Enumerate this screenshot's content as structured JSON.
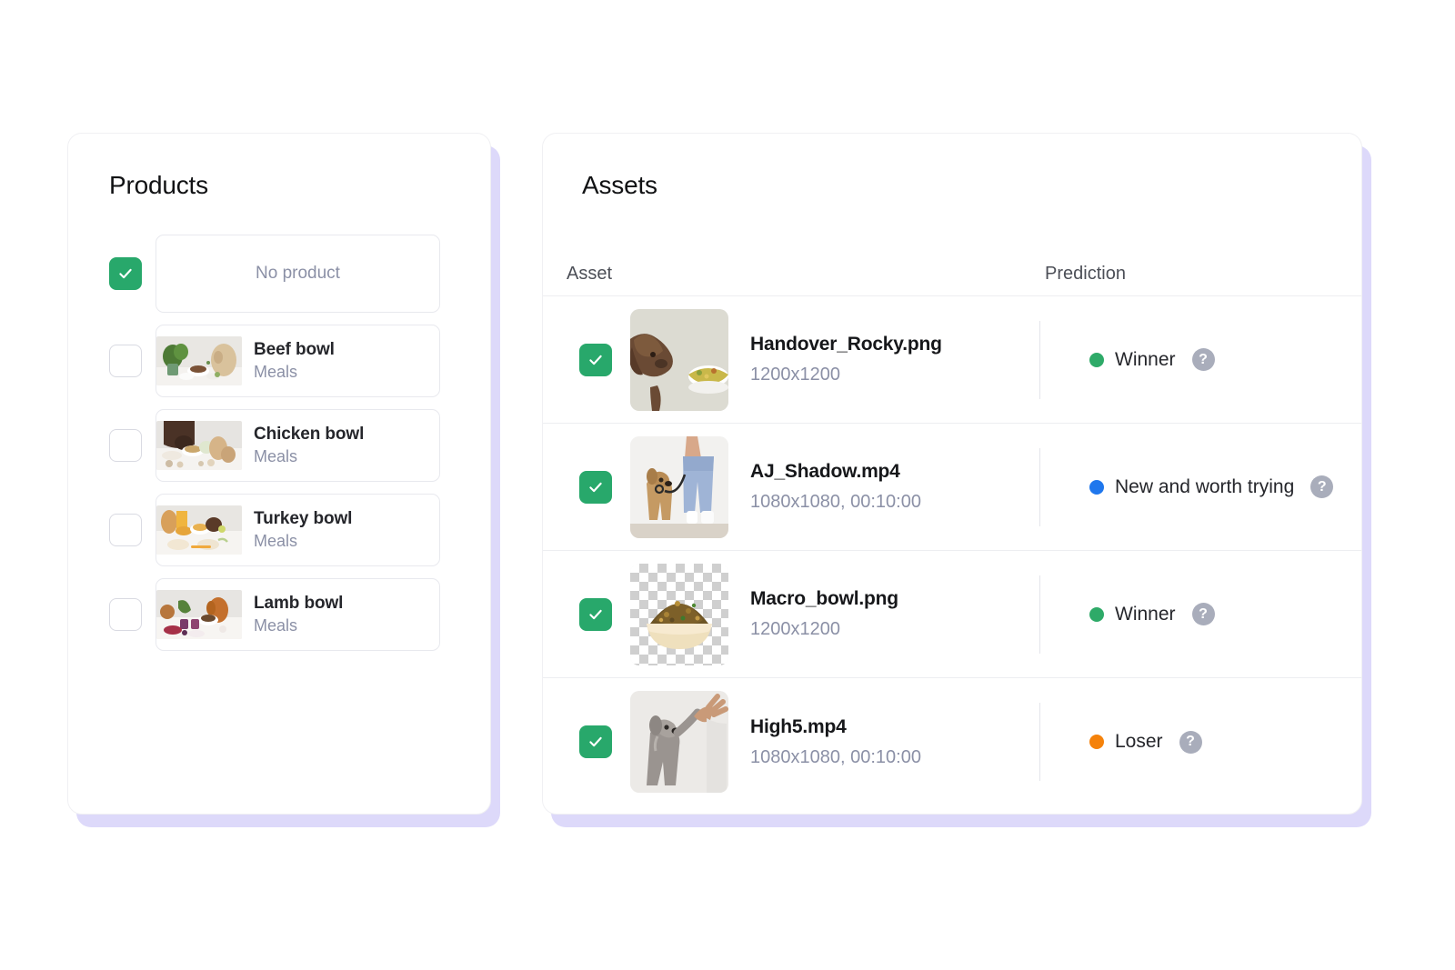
{
  "theme": {
    "accent_green": "#28a86b",
    "status_winner": "#2eaa68",
    "status_new": "#1f77ed",
    "status_loser": "#f5820b",
    "card_shadow": "#ddd9fa",
    "muted_text": "#8b90a6"
  },
  "products_panel": {
    "title": "Products",
    "items": [
      {
        "checked": true,
        "empty": true,
        "empty_label": "No product",
        "name": "",
        "category": "",
        "thumb": "no-product-placeholder"
      },
      {
        "checked": false,
        "empty": false,
        "name": "Beef bowl",
        "category": "Meals",
        "thumb": "beef-bowl-thumbnail"
      },
      {
        "checked": false,
        "empty": false,
        "name": "Chicken bowl",
        "category": "Meals",
        "thumb": "chicken-bowl-thumbnail"
      },
      {
        "checked": false,
        "empty": false,
        "name": "Turkey bowl",
        "category": "Meals",
        "thumb": "turkey-bowl-thumbnail"
      },
      {
        "checked": false,
        "empty": false,
        "name": "Lamb bowl",
        "category": "Meals",
        "thumb": "lamb-bowl-thumbnail"
      }
    ]
  },
  "assets_panel": {
    "title": "Assets",
    "columns": {
      "asset": "Asset",
      "prediction": "Prediction"
    },
    "help_glyph": "?",
    "rows": [
      {
        "checked": true,
        "name": "Handover_Rocky.png",
        "dimensions": "1200x1200",
        "prediction": "Winner",
        "prediction_color": "#2eaa68",
        "thumb": "dog-with-food-bowl-thumbnail"
      },
      {
        "checked": true,
        "name": "AJ_Shadow.mp4",
        "dimensions": "1080x1080, 00:10:00",
        "prediction": "New and worth trying",
        "prediction_color": "#1f77ed",
        "thumb": "dog-on-leash-thumbnail"
      },
      {
        "checked": true,
        "name": "Macro_bowl.png",
        "dimensions": "1200x1200",
        "prediction": "Winner",
        "prediction_color": "#2eaa68",
        "thumb": "transparent-kibble-bowl-thumbnail"
      },
      {
        "checked": true,
        "name": "High5.mp4",
        "dimensions": "1080x1080, 00:10:00",
        "prediction": "Loser",
        "prediction_color": "#f5820b",
        "thumb": "dog-high-five-thumbnail"
      }
    ]
  }
}
